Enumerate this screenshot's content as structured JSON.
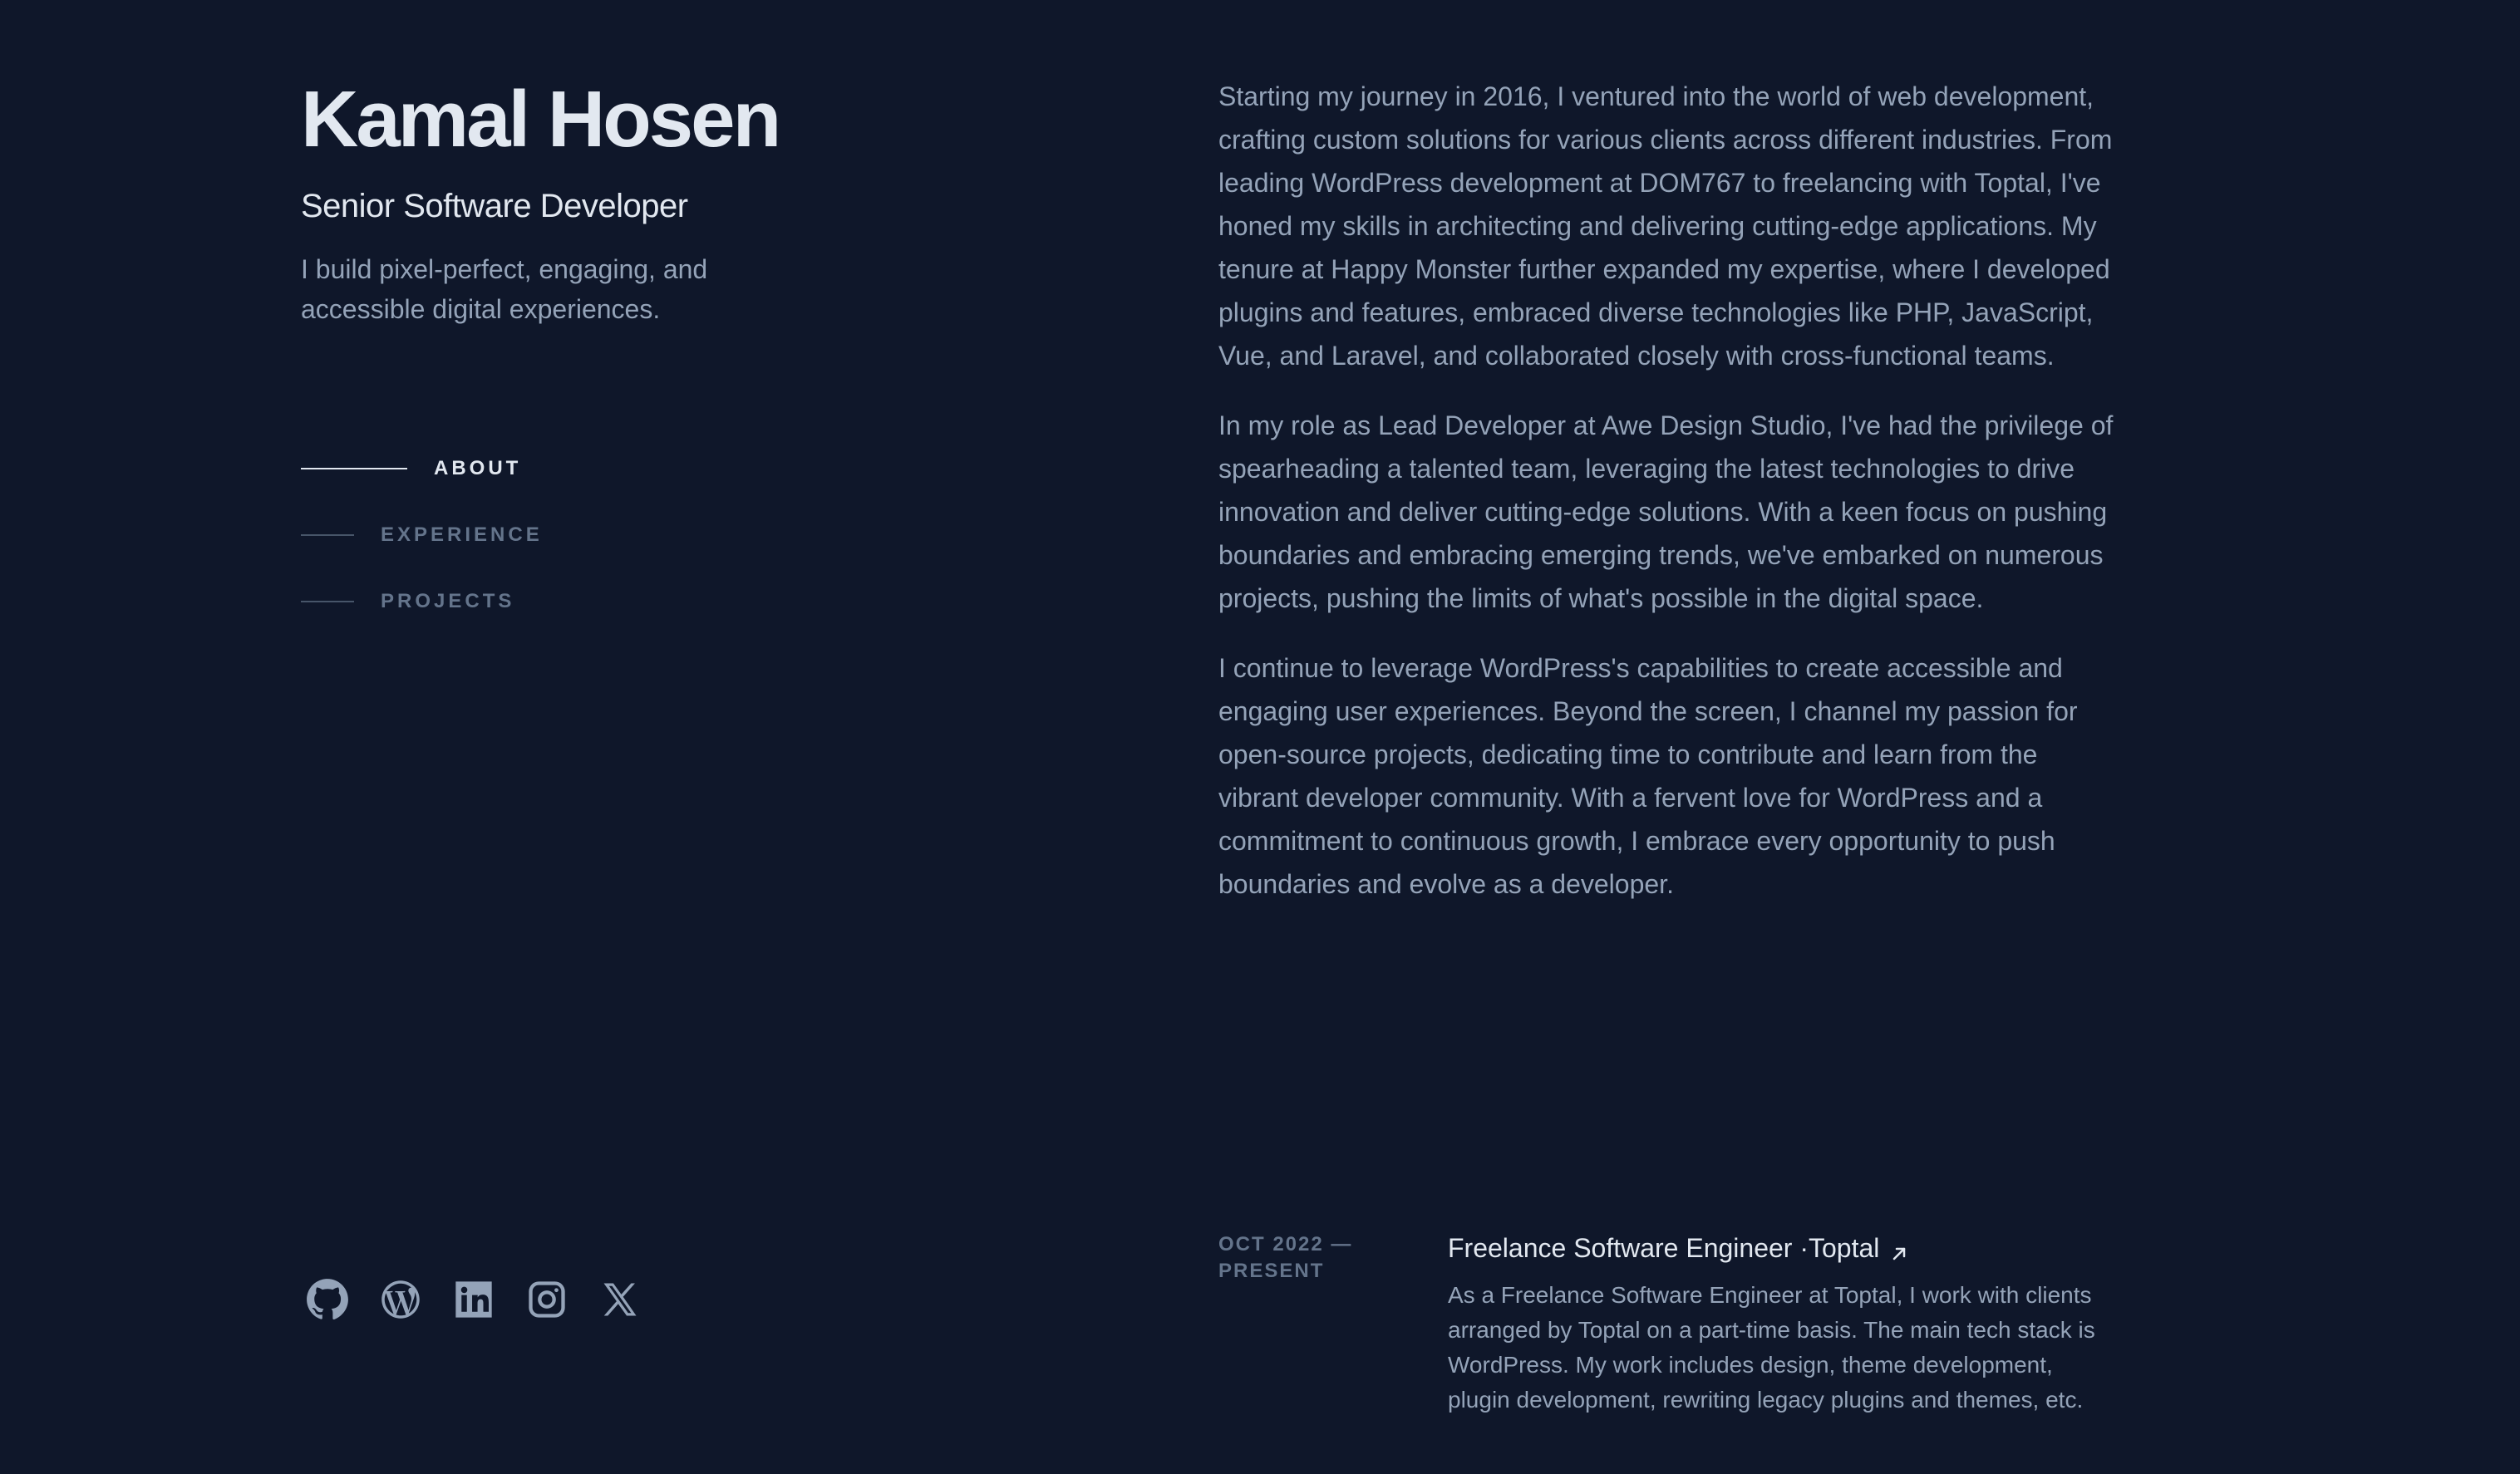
{
  "header": {
    "name": "Kamal Hosen",
    "role": "Senior Software Developer",
    "tagline": "I build pixel-perfect, engaging, and accessible digital experiences."
  },
  "nav": {
    "items": [
      {
        "label": "ABOUT",
        "active": true
      },
      {
        "label": "EXPERIENCE",
        "active": false
      },
      {
        "label": "PROJECTS",
        "active": false
      }
    ]
  },
  "socials": [
    {
      "icon": "github-icon"
    },
    {
      "icon": "wordpress-icon"
    },
    {
      "icon": "linkedin-icon"
    },
    {
      "icon": "instagram-icon"
    },
    {
      "icon": "x-twitter-icon"
    }
  ],
  "about": {
    "paragraphs": [
      "Starting my journey in 2016, I ventured into the world of web development, crafting custom solutions for various clients across different industries. From leading WordPress development at DOM767 to freelancing with Toptal, I've honed my skills in architecting and delivering cutting-edge applications. My tenure at Happy Monster further expanded my expertise, where I developed plugins and features, embraced diverse technologies like PHP, JavaScript, Vue, and Laravel, and collaborated closely with cross-functional teams.",
      "In my role as Lead Developer at Awe Design Studio, I've had the privilege of spearheading a talented team, leveraging the latest technologies to drive innovation and deliver cutting-edge solutions. With a keen focus on pushing boundaries and embracing emerging trends, we've embarked on numerous projects, pushing the limits of what's possible in the digital space.",
      "I continue to leverage WordPress's capabilities to create accessible and engaging user experiences. Beyond the screen, I channel my passion for open-source projects, dedicating time to contribute and learn from the vibrant developer community. With a fervent love for WordPress and a commitment to continuous growth, I embrace every opportunity to push boundaries and evolve as a developer."
    ]
  },
  "experience": [
    {
      "date": "OCT 2022 — PRESENT",
      "title": "Freelance Software Engineer ·Toptal",
      "description": "As a Freelance Software Engineer at Toptal, I work with clients arranged by Toptal on a part-time basis. The main tech stack is WordPress. My work includes design, theme development, plugin development, rewriting legacy plugins and themes, etc."
    }
  ],
  "colors": {
    "background": "#0f172a",
    "heading": "#e2e8f0",
    "body_text": "#94a3b8",
    "muted": "#64748b"
  }
}
